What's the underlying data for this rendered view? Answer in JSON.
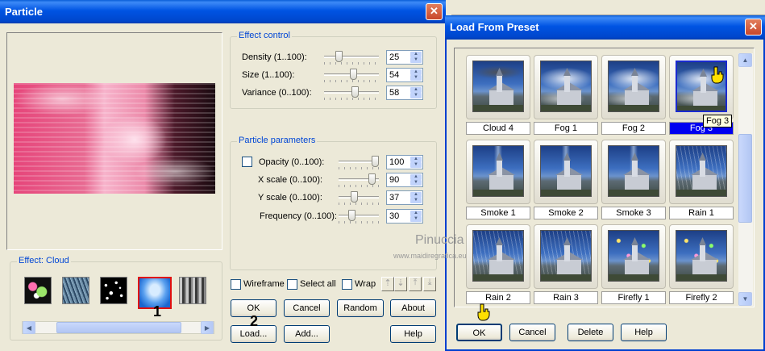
{
  "particle_dialog": {
    "title": "Particle",
    "effect_control": {
      "title": "Effect control",
      "rows": [
        {
          "label": "Density (1..100):",
          "value": "25",
          "level": 0.24
        },
        {
          "label": "Size (1..100):",
          "value": "54",
          "level": 0.54
        },
        {
          "label": "Variance (0..100):",
          "value": "58",
          "level": 0.58
        }
      ]
    },
    "particle_parameters": {
      "title": "Particle parameters",
      "rows": [
        {
          "label": "Opacity (0..100):",
          "value": "100",
          "level": 1.0
        },
        {
          "label": "X scale (0..100):",
          "value": "90",
          "level": 0.9
        },
        {
          "label": "Y scale (0..100):",
          "value": "37",
          "level": 0.37
        },
        {
          "label": "Frequency (0..100):",
          "value": "30",
          "level": 0.3
        }
      ]
    },
    "effect_group": {
      "title": "Effect: Cloud"
    },
    "checkboxes": {
      "wireframe": "Wireframe",
      "select_all": "Select all",
      "wrap": "Wrap"
    },
    "buttons": {
      "ok": "OK",
      "cancel": "Cancel",
      "random": "Random",
      "about": "About",
      "load": "Load...",
      "add": "Add...",
      "help": "Help"
    },
    "step_markers": {
      "one": "1",
      "two": "2"
    }
  },
  "preset_dialog": {
    "title": "Load From Preset",
    "presets": [
      {
        "name": "Cloud 4",
        "kind": "cloud"
      },
      {
        "name": "Fog 1",
        "kind": "fog"
      },
      {
        "name": "Fog 2",
        "kind": "fog"
      },
      {
        "name": "Fog 3",
        "kind": "fog",
        "selected": true
      },
      {
        "name": "Smoke 1",
        "kind": "smoke"
      },
      {
        "name": "Smoke 2",
        "kind": "smoke"
      },
      {
        "name": "Smoke 3",
        "kind": "smoke"
      },
      {
        "name": "Rain 1",
        "kind": "rain"
      },
      {
        "name": "Rain 2",
        "kind": "rain"
      },
      {
        "name": "Rain 3",
        "kind": "rain"
      },
      {
        "name": "Firefly 1",
        "kind": "firefly"
      },
      {
        "name": "Firefly 2",
        "kind": "firefly"
      }
    ],
    "tooltip": "Fog 3",
    "buttons": {
      "ok": "OK",
      "cancel": "Cancel",
      "delete": "Delete",
      "help": "Help"
    }
  },
  "watermark": {
    "name": "Pinuccia",
    "url": "www.maidiregrafica.eu"
  },
  "colors": {
    "title_blue": "#0054e3",
    "marker_red": "#e01010",
    "selection_blue": "#0000f0"
  }
}
